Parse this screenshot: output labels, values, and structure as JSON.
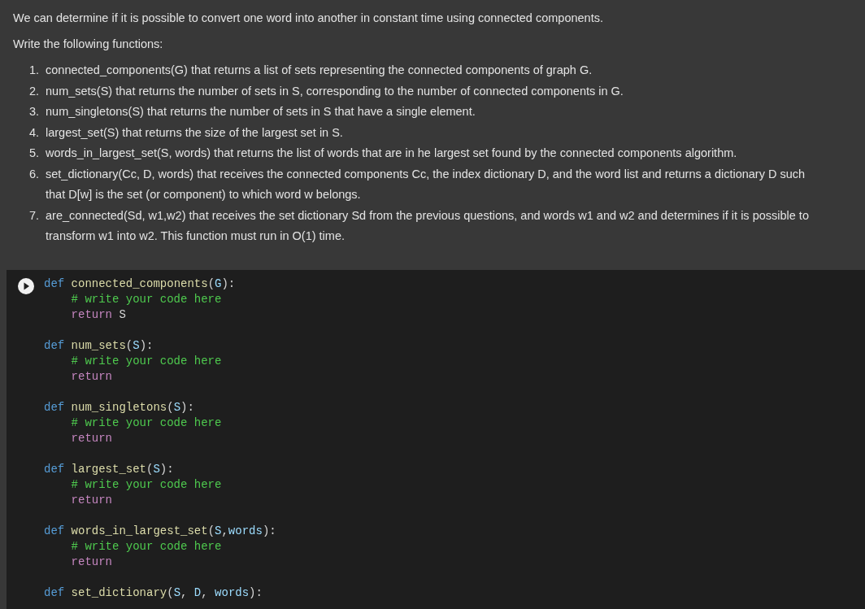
{
  "markdown_cell": {
    "paragraphs": [
      "We can determine if it is possible to convert one word into another in constant time using connected components.",
      "Write the following functions:"
    ],
    "list": [
      {
        "number": "1.",
        "text": "connected_components(G) that returns a list of sets representing the connected components of graph G."
      },
      {
        "number": "2.",
        "text": "num_sets(S) that returns the number of sets in S, corresponding to the number of connected components in G."
      },
      {
        "number": "3.",
        "text": "num_singletons(S) that returns the number of sets in S that have a single element."
      },
      {
        "number": "4.",
        "text": "largest_set(S) that returns the size of the largest set in S."
      },
      {
        "number": "5.",
        "text": "words_in_largest_set(S, words) that returns the list of words that are in he largest set found by the connected components algorithm."
      },
      {
        "number": "6.",
        "text": "set_dictionary(Cc, D, words) that receives the connected components Cc, the index dictionary D, and the word list and returns a dictionary D such that D[w] is the set (or component) to which word w belongs."
      },
      {
        "number": "7.",
        "text": "are_connected(Sd, w1,w2) that receives the set dictionary Sd from the previous questions, and words w1 and w2 and determines if it is possible to transform w1 into w2. This function must run in O(1) time."
      }
    ]
  },
  "code_cell": {
    "blocks": [
      {
        "header": [
          {
            "kind": "keyword",
            "text": "def"
          },
          {
            "kind": "function",
            "text": "connected_components"
          },
          {
            "kind": "plain",
            "text": "("
          },
          {
            "kind": "param",
            "text": "G"
          },
          {
            "kind": "plain",
            "text": "):"
          }
        ],
        "children": [
          [
            {
              "kind": "comment",
              "text": "# write your code here"
            }
          ],
          [
            {
              "kind": "return",
              "text": "return"
            },
            {
              "kind": "plain",
              "text": " S"
            }
          ]
        ]
      },
      {
        "header": [
          {
            "kind": "keyword",
            "text": "def"
          },
          {
            "kind": "function",
            "text": "num_sets"
          },
          {
            "kind": "plain",
            "text": "("
          },
          {
            "kind": "param",
            "text": "S"
          },
          {
            "kind": "plain",
            "text": "):"
          }
        ],
        "children": [
          [
            {
              "kind": "comment",
              "text": "# write your code here"
            }
          ],
          [
            {
              "kind": "return",
              "text": "return"
            }
          ]
        ]
      },
      {
        "header": [
          {
            "kind": "keyword",
            "text": "def"
          },
          {
            "kind": "function",
            "text": "num_singletons"
          },
          {
            "kind": "plain",
            "text": "("
          },
          {
            "kind": "param",
            "text": "S"
          },
          {
            "kind": "plain",
            "text": "):"
          }
        ],
        "children": [
          [
            {
              "kind": "comment",
              "text": "# write your code here"
            }
          ],
          [
            {
              "kind": "return",
              "text": "return"
            }
          ]
        ]
      },
      {
        "header": [
          {
            "kind": "keyword",
            "text": "def"
          },
          {
            "kind": "function",
            "text": "largest_set"
          },
          {
            "kind": "plain",
            "text": "("
          },
          {
            "kind": "param",
            "text": "S"
          },
          {
            "kind": "plain",
            "text": "):"
          }
        ],
        "children": [
          [
            {
              "kind": "comment",
              "text": "# write your code here"
            }
          ],
          [
            {
              "kind": "return",
              "text": "return"
            }
          ]
        ]
      },
      {
        "header": [
          {
            "kind": "keyword",
            "text": "def"
          },
          {
            "kind": "function",
            "text": "words_in_largest_set"
          },
          {
            "kind": "plain",
            "text": "("
          },
          {
            "kind": "param",
            "text": "S"
          },
          {
            "kind": "plain",
            "text": ","
          },
          {
            "kind": "param",
            "text": "words"
          },
          {
            "kind": "plain",
            "text": "):"
          }
        ],
        "children": [
          [
            {
              "kind": "comment",
              "text": "# write your code here"
            }
          ],
          [
            {
              "kind": "return",
              "text": "return"
            }
          ]
        ]
      },
      {
        "header": [
          {
            "kind": "keyword",
            "text": "def"
          },
          {
            "kind": "function",
            "text": "set_dictionary"
          },
          {
            "kind": "plain",
            "text": "("
          },
          {
            "kind": "param",
            "text": "S"
          },
          {
            "kind": "plain",
            "text": ", "
          },
          {
            "kind": "param",
            "text": "D"
          },
          {
            "kind": "plain",
            "text": ", "
          },
          {
            "kind": "param",
            "text": "words"
          },
          {
            "kind": "plain",
            "text": "):"
          }
        ]
      }
    ]
  }
}
